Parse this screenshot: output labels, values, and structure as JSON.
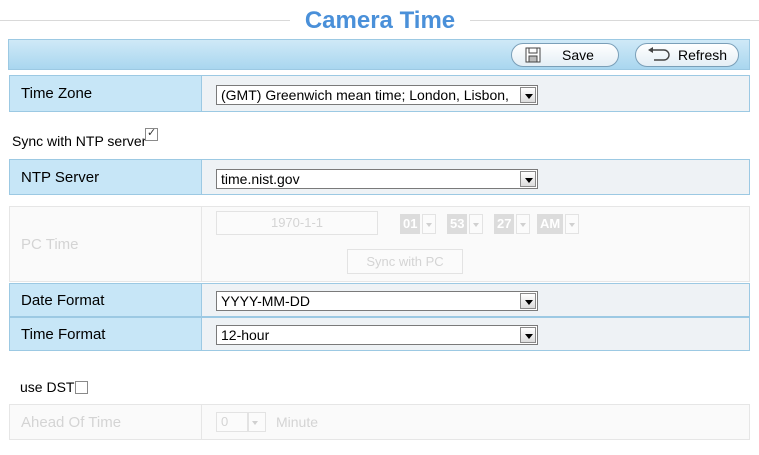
{
  "page": {
    "title": "Camera Time"
  },
  "toolbar": {
    "save_label": "Save",
    "refresh_label": "Refresh",
    "save_icon": "floppy-icon",
    "refresh_icon": "refresh-icon"
  },
  "time_zone": {
    "label": "Time Zone",
    "value": "(GMT) Greenwich mean time; London, Lisbon,"
  },
  "ntp_sync": {
    "label": "Sync with NTP server",
    "checked": true
  },
  "ntp_server": {
    "label": "NTP Server",
    "value": "time.nist.gov"
  },
  "pc_time": {
    "label": "PC Time",
    "date": "1970-1-1",
    "hour": "01",
    "minute": "53",
    "second": "27",
    "ampm": "AM",
    "sync_button": "Sync with PC"
  },
  "date_format": {
    "label": "Date Format",
    "value": "YYYY-MM-DD"
  },
  "time_format": {
    "label": "Time Format",
    "value": "12-hour"
  },
  "dst": {
    "label": "use DST",
    "checked": false
  },
  "ahead_of_time": {
    "label": "Ahead Of Time",
    "value": "0",
    "unit": "Minute"
  },
  "colors": {
    "accent": "#4a90d9",
    "label_bg": "#c7e6f7",
    "border": "#9cc9e3"
  }
}
